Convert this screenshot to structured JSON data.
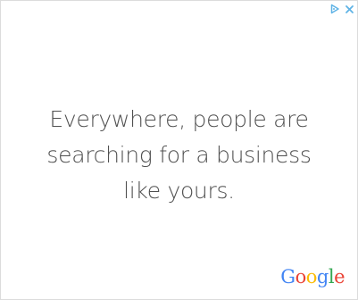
{
  "ad": {
    "message_lines": [
      "Everywhere, people are",
      "searching for a business",
      "like yours."
    ],
    "logo_letters": [
      {
        "char": "G",
        "color": "#4285F4"
      },
      {
        "char": "o",
        "color": "#EA4335"
      },
      {
        "char": "o",
        "color": "#FBBC05"
      },
      {
        "char": "g",
        "color": "#4285F4"
      },
      {
        "char": "l",
        "color": "#34A853"
      },
      {
        "char": "e",
        "color": "#EA4335"
      }
    ],
    "logo_text": "Google",
    "icons": {
      "adchoices": "adchoices-triangle-icon",
      "close": "close-icon"
    },
    "colors": {
      "text": "#505050",
      "icon": "#5fb3e6",
      "border": "#dcdcdc"
    }
  }
}
